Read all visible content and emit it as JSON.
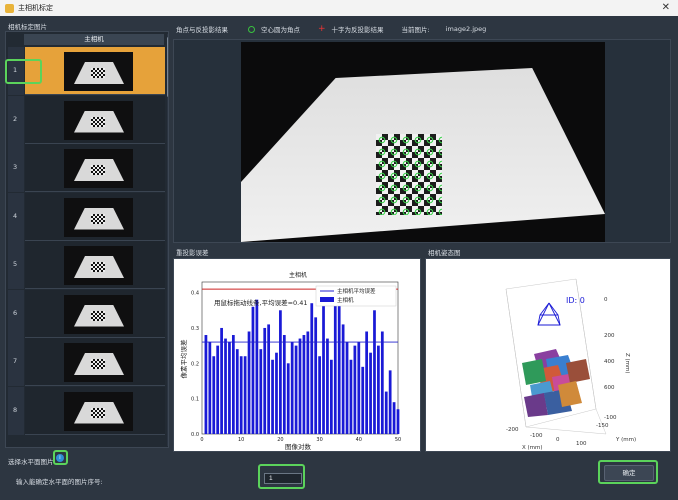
{
  "window": {
    "title": "主相机标定",
    "close_glyph": "✕"
  },
  "list": {
    "label": "相机标定图片",
    "header": "主相机",
    "selected_index": 0,
    "rows": [
      "1",
      "2",
      "3",
      "4",
      "5",
      "6",
      "7",
      "8"
    ]
  },
  "legend": {
    "title": "角点与反投影结果",
    "circle_label": "空心圆为角点",
    "cross_label": "十字为反投影结果",
    "current_label": "当前图片:",
    "current_value": "image2.jpeg"
  },
  "reproj": {
    "label": "重投影误差",
    "chart_data": {
      "type": "bar",
      "title": "主相机",
      "xlabel": "图像对数",
      "ylabel": "像素平均误差",
      "annotation": "用鼠标拖动线条,平均误差=0.41",
      "legend": [
        "主相机平均误差",
        "主相机"
      ],
      "legend_position": "top-right",
      "xlim": [
        0,
        50
      ],
      "ylim": [
        0,
        0.43
      ],
      "x_ticks": [
        0,
        10,
        20,
        30,
        40,
        50
      ],
      "y_ticks": [
        0.0,
        0.1,
        0.2,
        0.3,
        0.4
      ],
      "mean_line": 0.26,
      "threshold_line": 0.41,
      "values": [
        0.28,
        0.26,
        0.22,
        0.25,
        0.3,
        0.27,
        0.26,
        0.28,
        0.24,
        0.22,
        0.22,
        0.29,
        0.36,
        0.38,
        0.24,
        0.3,
        0.31,
        0.21,
        0.23,
        0.35,
        0.28,
        0.2,
        0.26,
        0.25,
        0.27,
        0.28,
        0.29,
        0.37,
        0.33,
        0.22,
        0.41,
        0.27,
        0.21,
        0.4,
        0.38,
        0.31,
        0.26,
        0.21,
        0.25,
        0.26,
        0.19,
        0.29,
        0.23,
        0.35,
        0.25,
        0.29,
        0.12,
        0.18,
        0.09,
        0.07
      ]
    }
  },
  "pose": {
    "label": "相机姿态图",
    "id_text": "ID: 0",
    "x_label": "X (mm)",
    "y_label": "Y (mm)",
    "z_label": "Z (mm)",
    "x_ticks": [
      "-200",
      "-100",
      "0",
      "100"
    ],
    "y_ticks": [
      "-150",
      "-100"
    ],
    "z_ticks": [
      "0",
      "200",
      "400",
      "600"
    ]
  },
  "bottom": {
    "plane_label": "选择水平面图片",
    "info_glyph": "i",
    "input_label": "输入能确定水平面的图片序号:",
    "input_value": "1",
    "ok_label": "确定"
  },
  "colors": {
    "bar": "#1a1ad6",
    "mean": "#2222cc",
    "threshold": "#cc2222",
    "selected_row": "#e6a23a",
    "highlight": "#5bd35b"
  }
}
